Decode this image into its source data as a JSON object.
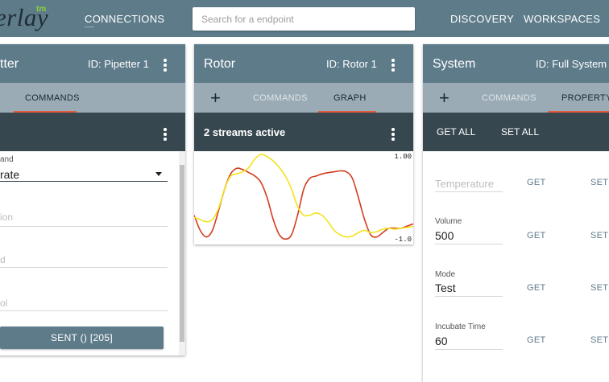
{
  "topbar": {
    "logo_text": "erlay",
    "logo_tm": "tm",
    "nav_connections": "CONNECTIONS",
    "search_placeholder": "Search for a endpoint",
    "nav_discovery": "DISCOVERY",
    "nav_workspaces": "WORKSPACES"
  },
  "colors": {
    "bar": "#5e7b8a",
    "tabs": "#9aabb5",
    "dark": "#37474f",
    "accent": "#e25a3a",
    "tm": "#8bd53a"
  },
  "pipetter": {
    "title": "tter",
    "id": "ID: Pipetter 1",
    "tab_commands": "COMMANDS",
    "command_label": "and",
    "command_value": "rate",
    "field1_placeholder": "ion",
    "field2_placeholder": "d",
    "field3_placeholder": "ol",
    "sent_button": "SENT () [205]"
  },
  "rotor": {
    "title": "Rotor",
    "id": "ID: Rotor 1",
    "tab_commands": "COMMANDS",
    "tab_graph": "GRAPH",
    "streams": "2 streams active",
    "y_max": "1.00",
    "y_min": "-1.0"
  },
  "system": {
    "title": "System",
    "id": "ID: Full System",
    "tab_commands": "COMMANDS",
    "tab_property": "PROPERTY",
    "get_all": "GET ALL",
    "set_all": "SET ALL",
    "get_label": "GET",
    "set_label": "SET",
    "fields": [
      {
        "label": "",
        "placeholder": "Temperature",
        "value": ""
      },
      {
        "label": "Volume",
        "placeholder": "",
        "value": "500"
      },
      {
        "label": "Mode",
        "placeholder": "",
        "value": "Test"
      },
      {
        "label": "Incubate Time",
        "placeholder": "",
        "value": "60"
      }
    ]
  },
  "chart_data": {
    "type": "line",
    "ylim": [
      -1,
      1
    ],
    "y_tick_labels": [
      "1.00",
      "-1.0"
    ],
    "series": [
      {
        "color": "#d43c1e",
        "x": [
          0,
          1,
          2,
          3,
          4,
          5,
          6,
          7,
          8,
          9,
          10,
          11,
          12,
          13,
          14,
          15,
          16,
          17,
          18,
          19,
          20,
          21,
          22,
          23,
          24,
          25,
          26,
          27,
          28,
          29,
          30,
          31,
          32,
          33,
          34,
          35,
          36
        ],
        "y": [
          -0.4,
          -0.75,
          -0.9,
          -0.75,
          -0.3,
          0.2,
          0.55,
          0.68,
          0.65,
          0.58,
          0.5,
          0.35,
          0.0,
          -0.5,
          -0.85,
          -0.95,
          -0.85,
          -0.4,
          0.2,
          0.45,
          0.5,
          0.55,
          0.58,
          0.6,
          0.62,
          0.6,
          0.45,
          0.0,
          -0.5,
          -0.85,
          -0.9,
          -0.8,
          -0.7,
          -0.7,
          -0.7,
          -0.65,
          -0.6
        ]
      },
      {
        "color": "#f2e21b",
        "x": [
          0,
          1,
          2,
          3,
          4,
          5,
          6,
          7,
          8,
          9,
          10,
          11,
          12,
          13,
          14,
          15,
          16,
          17,
          18,
          19,
          20,
          21,
          22,
          23,
          24,
          25,
          26,
          27,
          28,
          29,
          30,
          31,
          32,
          33,
          34,
          35,
          36
        ],
        "y": [
          -0.45,
          -0.5,
          -0.55,
          -0.5,
          -0.25,
          0.2,
          0.5,
          0.55,
          0.6,
          0.7,
          0.9,
          1.0,
          0.95,
          0.85,
          0.7,
          0.5,
          0.2,
          -0.2,
          -0.4,
          -0.4,
          -0.35,
          -0.4,
          -0.55,
          -0.75,
          -0.85,
          -0.9,
          -0.88,
          -0.8,
          -0.75,
          -0.8,
          -0.78,
          -0.72,
          -0.7,
          -0.72,
          -0.7,
          -0.68,
          -0.66
        ]
      }
    ]
  }
}
